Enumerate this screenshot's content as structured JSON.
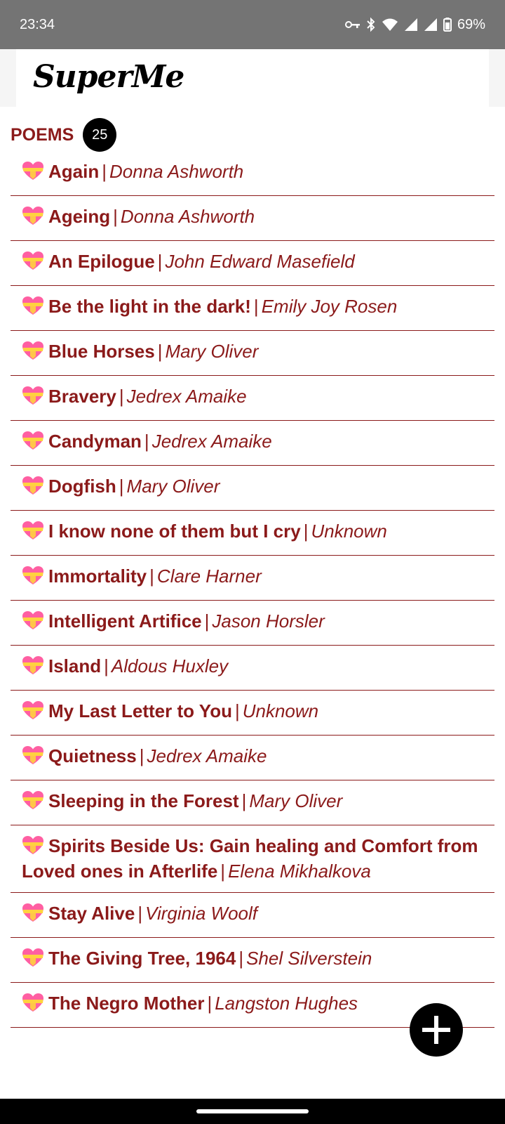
{
  "status": {
    "time": "23:34",
    "battery": "69%",
    "icons": [
      "vpn-key-icon",
      "bluetooth-icon",
      "wifi-icon",
      "signal-icon",
      "signal-icon",
      "battery-icon"
    ]
  },
  "app": {
    "logo_text": "SuperMe"
  },
  "section": {
    "title": "POEMS",
    "count": "25"
  },
  "colors": {
    "accent": "#8b1a1a",
    "statusbar": "#747474",
    "badge": "#000000"
  },
  "poems": [
    {
      "title": "Again",
      "author": "Donna Ashworth"
    },
    {
      "title": "Ageing",
      "author": "Donna Ashworth"
    },
    {
      "title": "An Epilogue",
      "author": "John Edward Masefield"
    },
    {
      "title": "Be the light in the dark!",
      "author": "Emily Joy Rosen"
    },
    {
      "title": "Blue Horses",
      "author": "Mary Oliver"
    },
    {
      "title": "Bravery",
      "author": "Jedrex Amaike"
    },
    {
      "title": "Candyman",
      "author": "Jedrex Amaike"
    },
    {
      "title": "Dogfish",
      "author": "Mary Oliver"
    },
    {
      "title": "I know none of them but I cry",
      "author": "Unknown"
    },
    {
      "title": "Immortality",
      "author": "Clare Harner"
    },
    {
      "title": "Intelligent Artifice",
      "author": "Jason Horsler"
    },
    {
      "title": "Island",
      "author": "Aldous Huxley"
    },
    {
      "title": "My Last Letter to You",
      "author": "Unknown"
    },
    {
      "title": "Quietness",
      "author": "Jedrex Amaike"
    },
    {
      "title": "Sleeping in the Forest",
      "author": "Mary Oliver"
    },
    {
      "title": "Spirits Beside Us: Gain healing and Comfort from Loved ones in Afterlife",
      "author": "Elena Mikhalkova"
    },
    {
      "title": "Stay Alive",
      "author": "Virginia Woolf"
    },
    {
      "title": "The Giving Tree, 1964",
      "author": "Shel Silverstein"
    },
    {
      "title": "The Negro Mother",
      "author": "Langston Hughes"
    }
  ],
  "separator": "|",
  "fab": {
    "icon": "plus-icon"
  }
}
